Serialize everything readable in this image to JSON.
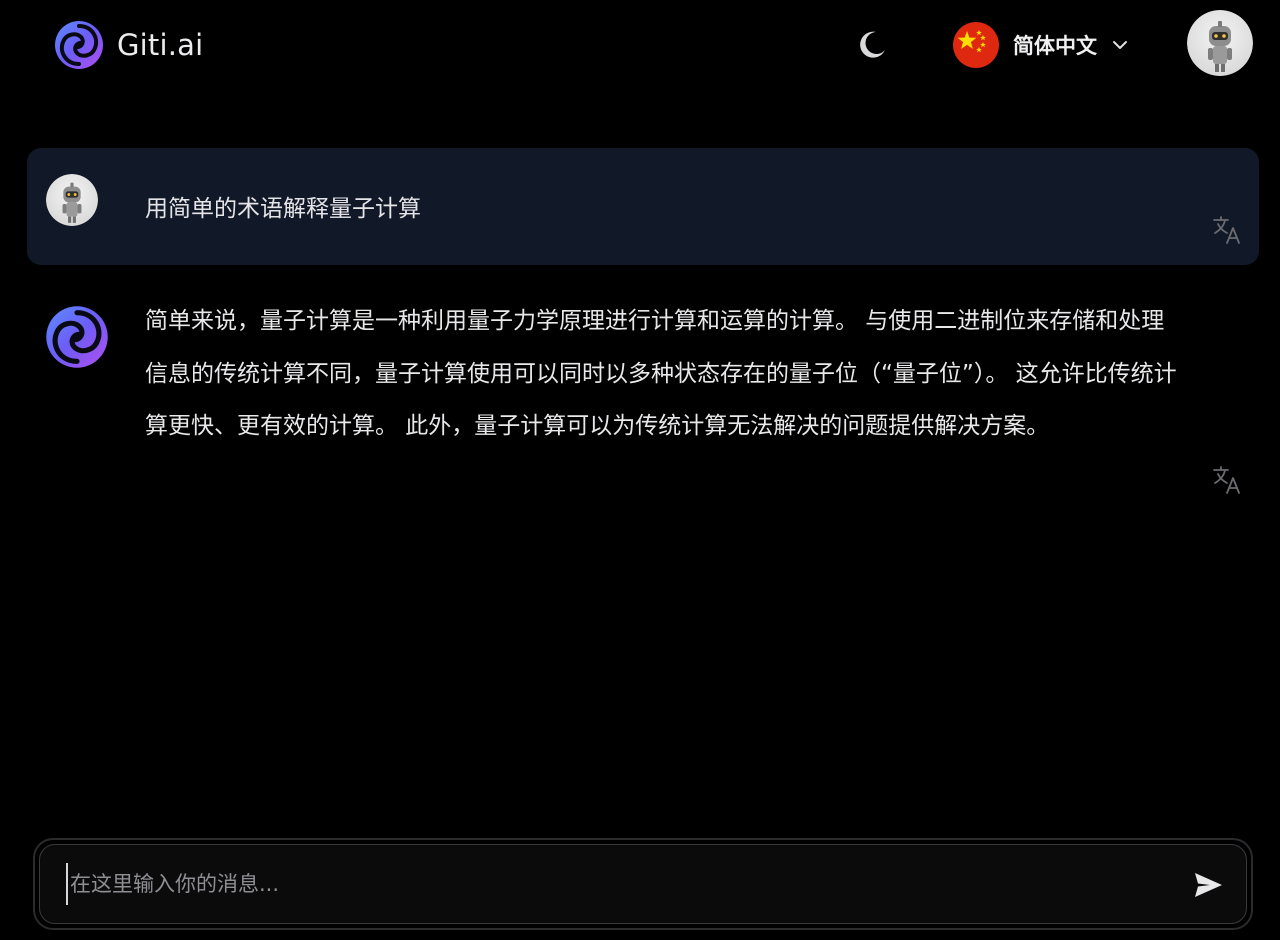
{
  "header": {
    "brand_name": "Giti.ai",
    "theme_icon": "moon-icon",
    "language": {
      "flag_icon": "china-flag-icon",
      "label": "简体中文",
      "dropdown_icon": "chevron-down-icon"
    },
    "user_avatar_icon": "robot-avatar-icon"
  },
  "conversation": {
    "user_message": {
      "avatar_icon": "robot-avatar-icon",
      "text": "用简单的术语解释量子计算",
      "action_icon": "translate-icon"
    },
    "ai_message": {
      "avatar_icon": "giti-logo-icon",
      "text": "简单来说，量子计算是一种利用量子力学原理进行计算和运算的计算。 与使用二进制位来存储和处理信息的传统计算不同，量子计算使用可以同时以多种状态存在的量子位（“量子位”）。 这允许比传统计算更快、更有效的计算。 此外，量子计算可以为传统计算无法解决的问题提供解决方案。",
      "action_icon": "translate-icon"
    }
  },
  "composer": {
    "placeholder": "在这里输入你的消息...",
    "value": "",
    "send_icon": "send-icon"
  },
  "colors": {
    "background": "#000000",
    "user_bubble": "#111827",
    "logo_gradient_start": "#6d6cf7",
    "logo_gradient_end": "#a855f7",
    "flag_red": "#de2910",
    "flag_star": "#ffde00",
    "text": "#e8e8ea",
    "placeholder": "#8e8e93"
  }
}
